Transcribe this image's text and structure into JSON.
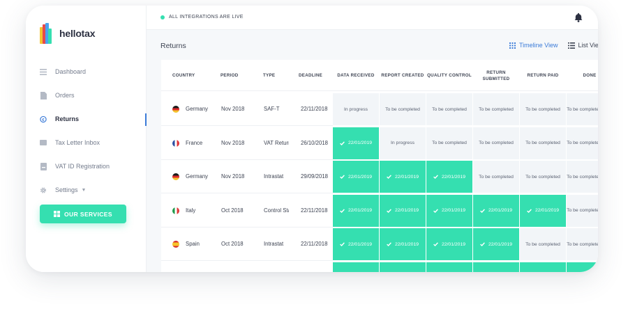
{
  "brand": {
    "name": "hellotax"
  },
  "sidebar": {
    "items": [
      {
        "label": "Dashboard",
        "icon": "menu-lines-icon"
      },
      {
        "label": "Orders",
        "icon": "document-icon"
      },
      {
        "label": "Returns",
        "icon": "returns-icon"
      },
      {
        "label": "Tax Letter Inbox",
        "icon": "inbox-icon"
      },
      {
        "label": "VAT ID Registration",
        "icon": "id-card-icon"
      },
      {
        "label": "Settings",
        "icon": "gear-icon"
      }
    ],
    "active": "Returns",
    "services_button": "OUR SERVICES"
  },
  "topbar": {
    "status_text": "ALL INTEGRATIONS ARE LIVE",
    "status_color": "#35dfb0"
  },
  "page": {
    "title": "Returns",
    "views": [
      {
        "label": "Timeline View",
        "active": true
      },
      {
        "label": "List View",
        "active": false
      }
    ]
  },
  "table": {
    "columns": [
      "COUNTRY",
      "PERIOD",
      "TYPE",
      "DEADLINE",
      "DATA RECEIVED",
      "REPORT CREATED",
      "QUALITY CONTROL",
      "RETURN SUBMITTED",
      "RETURN PAID",
      "DONE"
    ],
    "rows": [
      {
        "country": "Germany",
        "flag": "de",
        "period": "Nov 2018",
        "type": "SAF-T",
        "deadline": "22/11/2018",
        "stages": [
          "In progress",
          "To be completed",
          "To be completed",
          "To be completed",
          "To be completed",
          "To be completed"
        ],
        "done": [
          false,
          false,
          false,
          false,
          false,
          false
        ]
      },
      {
        "country": "France",
        "flag": "fr",
        "period": "Nov 2018",
        "type": "VAT Return",
        "deadline": "26/10/2018",
        "stages": [
          "22/01/2019",
          "In progress",
          "To be completed",
          "To be completed",
          "To be completed",
          "To be completed"
        ],
        "done": [
          true,
          false,
          false,
          false,
          false,
          false
        ]
      },
      {
        "country": "Germany",
        "flag": "de",
        "period": "Nov 2018",
        "type": "Intrastat",
        "deadline": "29/09/2018",
        "stages": [
          "22/01/2019",
          "22/01/2019",
          "22/01/2019",
          "To be completed",
          "To be completed",
          "To be completed"
        ],
        "done": [
          true,
          true,
          true,
          false,
          false,
          false
        ]
      },
      {
        "country": "Italy",
        "flag": "it",
        "period": "Oct 2018",
        "type": "Control Statement",
        "deadline": "22/11/2018",
        "stages": [
          "22/01/2019",
          "22/01/2019",
          "22/01/2019",
          "22/01/2019",
          "22/01/2019",
          "To be completed"
        ],
        "done": [
          true,
          true,
          true,
          true,
          true,
          false
        ]
      },
      {
        "country": "Spain",
        "flag": "es",
        "period": "Oct 2018",
        "type": "Intrastat",
        "deadline": "22/11/2018",
        "stages": [
          "22/01/2019",
          "22/01/2019",
          "22/01/2019",
          "22/01/2019",
          "To be completed",
          "To be completed"
        ],
        "done": [
          true,
          true,
          true,
          true,
          false,
          false
        ]
      }
    ],
    "partial_row_done": [
      true,
      true,
      true,
      true,
      true,
      true
    ],
    "accent": "#35dfb0"
  }
}
